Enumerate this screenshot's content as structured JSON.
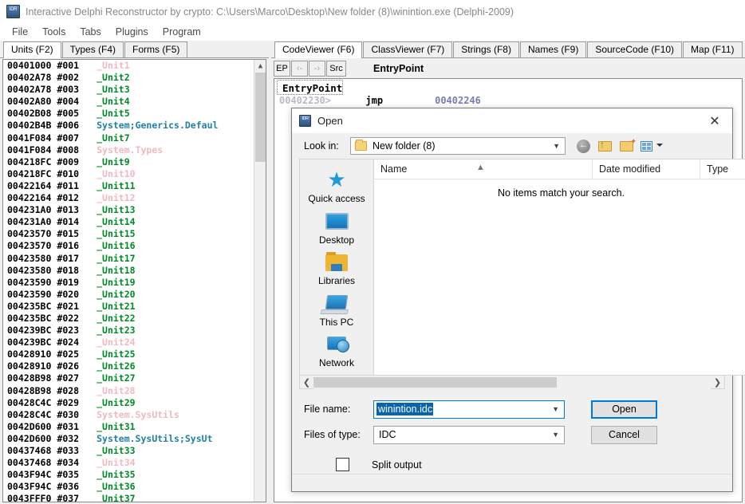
{
  "window": {
    "title": "Interactive Delphi Reconstructor by crypto: C:\\Users\\Marco\\Desktop\\New folder (8)\\winintion.exe (Delphi-2009)",
    "icon": "app-icon"
  },
  "menu": [
    "File",
    "Tools",
    "Tabs",
    "Plugins",
    "Program"
  ],
  "left_panel": {
    "tabs": [
      {
        "label": "Units (F2)",
        "active": true
      },
      {
        "label": "Types (F4)",
        "active": false
      },
      {
        "label": "Forms (F5)",
        "active": false
      }
    ],
    "units": [
      {
        "addr": "00401000",
        "idx": "#001",
        "name": "_Unit1",
        "style": "pink"
      },
      {
        "addr": "00402A78",
        "idx": "#002",
        "name": "_Unit2",
        "style": "green"
      },
      {
        "addr": "00402A78",
        "idx": "#003",
        "name": "_Unit3",
        "style": "green"
      },
      {
        "addr": "00402A80",
        "idx": "#004",
        "name": "_Unit4",
        "style": "green"
      },
      {
        "addr": "00402B08",
        "idx": "#005",
        "name": "_Unit5",
        "style": "green"
      },
      {
        "addr": "00402B4B",
        "idx": "#006",
        "name": "System;Generics.Defaul",
        "style": "blue"
      },
      {
        "addr": "0041F084",
        "idx": "#007",
        "name": "_Unit7",
        "style": "green"
      },
      {
        "addr": "0041F084",
        "idx": "#008",
        "name": "System.Types",
        "style": "pink"
      },
      {
        "addr": "004218FC",
        "idx": "#009",
        "name": "_Unit9",
        "style": "green"
      },
      {
        "addr": "004218FC",
        "idx": "#010",
        "name": "_Unit10",
        "style": "pink"
      },
      {
        "addr": "00422164",
        "idx": "#011",
        "name": "_Unit11",
        "style": "green"
      },
      {
        "addr": "00422164",
        "idx": "#012",
        "name": "_Unit12",
        "style": "pink"
      },
      {
        "addr": "004231A0",
        "idx": "#013",
        "name": "_Unit13",
        "style": "green"
      },
      {
        "addr": "004231A0",
        "idx": "#014",
        "name": "_Unit14",
        "style": "green"
      },
      {
        "addr": "00423570",
        "idx": "#015",
        "name": "_Unit15",
        "style": "green"
      },
      {
        "addr": "00423570",
        "idx": "#016",
        "name": "_Unit16",
        "style": "green"
      },
      {
        "addr": "00423580",
        "idx": "#017",
        "name": "_Unit17",
        "style": "green"
      },
      {
        "addr": "00423580",
        "idx": "#018",
        "name": "_Unit18",
        "style": "green"
      },
      {
        "addr": "00423590",
        "idx": "#019",
        "name": "_Unit19",
        "style": "green"
      },
      {
        "addr": "00423590",
        "idx": "#020",
        "name": "_Unit20",
        "style": "green"
      },
      {
        "addr": "004235BC",
        "idx": "#021",
        "name": "_Unit21",
        "style": "green"
      },
      {
        "addr": "004235BC",
        "idx": "#022",
        "name": "_Unit22",
        "style": "green"
      },
      {
        "addr": "004239BC",
        "idx": "#023",
        "name": "_Unit23",
        "style": "green"
      },
      {
        "addr": "004239BC",
        "idx": "#024",
        "name": "_Unit24",
        "style": "pink"
      },
      {
        "addr": "00428910",
        "idx": "#025",
        "name": "_Unit25",
        "style": "green"
      },
      {
        "addr": "00428910",
        "idx": "#026",
        "name": "_Unit26",
        "style": "green"
      },
      {
        "addr": "00428B98",
        "idx": "#027",
        "name": "_Unit27",
        "style": "green"
      },
      {
        "addr": "00428B98",
        "idx": "#028",
        "name": "_Unit28",
        "style": "pink"
      },
      {
        "addr": "00428C4C",
        "idx": "#029",
        "name": "_Unit29",
        "style": "green"
      },
      {
        "addr": "00428C4C",
        "idx": "#030",
        "name": "System.SysUtils",
        "style": "pink"
      },
      {
        "addr": "0042D600",
        "idx": "#031",
        "name": "_Unit31",
        "style": "green"
      },
      {
        "addr": "0042D600",
        "idx": "#032",
        "name": "System.SysUtils;SysUt",
        "style": "blue"
      },
      {
        "addr": "00437468",
        "idx": "#033",
        "name": "_Unit33",
        "style": "green"
      },
      {
        "addr": "00437468",
        "idx": "#034",
        "name": "_Unit34",
        "style": "pink"
      },
      {
        "addr": "0043F94C",
        "idx": "#035",
        "name": "_Unit35",
        "style": "green"
      },
      {
        "addr": "0043F94C",
        "idx": "#036",
        "name": "_Unit36",
        "style": "green"
      },
      {
        "addr": "0043FFF0",
        "idx": "#037",
        "name": "_Unit37",
        "style": "green"
      }
    ]
  },
  "right_panel": {
    "tabs": [
      {
        "label": "CodeViewer (F6)",
        "active": true
      },
      {
        "label": "ClassViewer (F7)",
        "active": false
      },
      {
        "label": "Strings (F8)",
        "active": false
      },
      {
        "label": "Names (F9)",
        "active": false
      },
      {
        "label": "SourceCode (F10)",
        "active": false
      },
      {
        "label": "Map (F11)",
        "active": false
      }
    ],
    "toolbar": {
      "ep_button": "EP",
      "back_button": "‹-",
      "forward_button": "-›",
      "src_button": "Src",
      "title": "EntryPoint"
    },
    "code": {
      "header": "EntryPoint",
      "line_address": "00402230>",
      "line_mnemonic": "jmp",
      "line_operand": "00402246"
    }
  },
  "dialog": {
    "title": "Open",
    "close_icon": "close-icon",
    "lookin_label": "Look in:",
    "lookin_value": "New folder (8)",
    "toolbar_icons": [
      "back-icon",
      "up-folder-icon",
      "new-folder-icon",
      "views-icon"
    ],
    "places": [
      {
        "label": "Quick access",
        "icon": "quick-access-icon"
      },
      {
        "label": "Desktop",
        "icon": "desktop-icon"
      },
      {
        "label": "Libraries",
        "icon": "libraries-icon"
      },
      {
        "label": "This PC",
        "icon": "this-pc-icon"
      },
      {
        "label": "Network",
        "icon": "network-icon"
      }
    ],
    "columns": [
      "Name",
      "Date modified",
      "Type"
    ],
    "empty_message": "No items match your search.",
    "filename_label": "File name:",
    "filename_value": "winintion.idc",
    "filetype_label": "Files of type:",
    "filetype_value": "IDC",
    "open_button": "Open",
    "cancel_button": "Cancel",
    "split_output_label": "Split output",
    "split_output_checked": false
  },
  "colors": {
    "unit_green": "#008a27",
    "unit_pink": "#f0b8c0",
    "unit_blue": "#1f7fa8",
    "accent_blue": "#0078d7",
    "selection_blue": "#0a64ad"
  }
}
